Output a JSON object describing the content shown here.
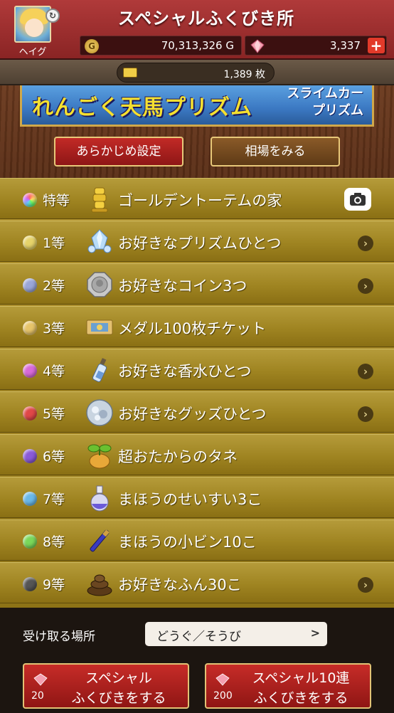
{
  "header": {
    "title": "スペシャルふくびき所",
    "player_name": "ヘイグ",
    "gold": "70,313,326 G",
    "gems": "3,337",
    "tickets": "1,389 枚",
    "plus_label": "+"
  },
  "banner": {
    "main": "れんごく天馬プリズム",
    "sub_top": "スライムカー",
    "sub_bottom": "プリズム"
  },
  "buttons": {
    "presets": "あらかじめ設定",
    "market": "相場をみる"
  },
  "prizes": [
    {
      "rank": "特等",
      "name": "ゴールデントーテムの家",
      "orb_color": "rainbow",
      "icon": "golden-totem-icon",
      "action": "camera"
    },
    {
      "rank": "1等",
      "name": "お好きなプリズムひとつ",
      "orb_color": "#e6d36a",
      "icon": "prism-icon",
      "action": "chevron"
    },
    {
      "rank": "2等",
      "name": "お好きなコイン3つ",
      "orb_color": "#9aa6d8",
      "icon": "coin-icon",
      "action": "chevron"
    },
    {
      "rank": "3等",
      "name": "メダル100枚チケット",
      "orb_color": "#e6c46a",
      "icon": "ticket-icon",
      "action": "none"
    },
    {
      "rank": "4等",
      "name": "お好きな香水ひとつ",
      "orb_color": "#d86ad8",
      "icon": "perfume-icon",
      "action": "chevron"
    },
    {
      "rank": "5等",
      "name": "お好きなグッズひとつ",
      "orb_color": "#e04848",
      "icon": "goods-icon",
      "action": "chevron"
    },
    {
      "rank": "6等",
      "name": "超おたからのタネ",
      "orb_color": "#8a5ad8",
      "icon": "seed-icon",
      "action": "none"
    },
    {
      "rank": "7等",
      "name": "まほうのせいすい3こ",
      "orb_color": "#6ab8e8",
      "icon": "holy-water-icon",
      "action": "none"
    },
    {
      "rank": "8等",
      "name": "まほうの小ビン10こ",
      "orb_color": "#7ad85a",
      "icon": "small-bottle-icon",
      "action": "none"
    },
    {
      "rank": "9等",
      "name": "お好きなふん30こ",
      "orb_color": "#555555",
      "icon": "dung-icon",
      "action": "chevron"
    }
  ],
  "footer": {
    "receive_label": "受け取る場所",
    "receive_value": "どうぐ／そうび",
    "receive_arrow": ">",
    "draw_single": {
      "line1": "スペシャル",
      "line2": "ふくびきをする",
      "cost": "20"
    },
    "draw_ten": {
      "line1": "スペシャル10連",
      "line2": "ふくびきをする",
      "cost": "200"
    }
  }
}
